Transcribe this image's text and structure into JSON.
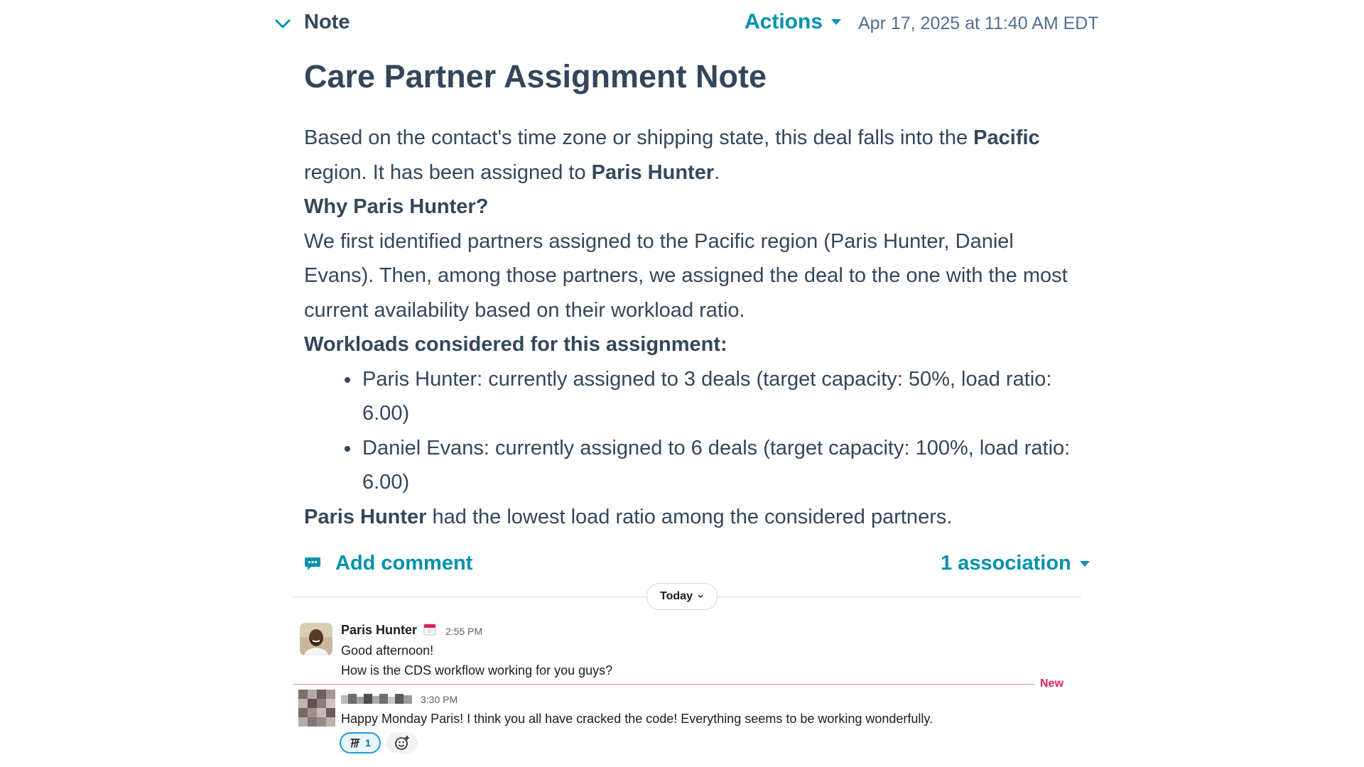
{
  "note": {
    "label": "Note",
    "actions_label": "Actions",
    "timestamp": "Apr 17, 2025 at 11:40 AM EDT",
    "title": "Care Partner Assignment Note",
    "intro_1": "Based on the contact's time zone or shipping state, this deal falls into the ",
    "region_bold": "Pacific",
    "intro_2": " region. It has been assigned to ",
    "assignee_bold": "Paris Hunter",
    "intro_3": ".",
    "why_heading": "Why Paris Hunter?",
    "why_text": "We first identified partners assigned to the Pacific region (Paris Hunter, Daniel Evans). Then, among those partners, we assigned the deal to the one with the most current availability based on their workload ratio.",
    "workloads_heading": "Workloads considered for this assignment:",
    "workloads": [
      "Paris Hunter: currently assigned to 3 deals (target capacity: 50%, load ratio: 6.00)",
      "Daniel Evans: currently assigned to 6 deals (target capacity: 100%, load ratio: 6.00)"
    ],
    "conclusion_bold": "Paris Hunter",
    "conclusion_text": " had the lowest load ratio among the considered partners.",
    "add_comment_label": "Add comment",
    "association_label": "1 association"
  },
  "chat": {
    "date_pill": "Today",
    "new_label": "New",
    "messages": [
      {
        "author": "Paris Hunter",
        "time": "2:55 PM",
        "lines": [
          "Good afternoon!",
          "How is the CDS workflow working for you guys?"
        ]
      },
      {
        "author": "",
        "time": "3:30 PM",
        "lines": [
          "Happy Monday Paris! I think you all have cracked the code! Everything seems to be working wonderfully."
        ],
        "reaction_count": "1"
      }
    ]
  },
  "icons": {
    "collapse": "chevron-down-icon",
    "comment": "comment-bubble-icon",
    "calendar_status": "calendar-icon",
    "reaction": "custom-emoji-icon",
    "add_reaction": "add-reaction-icon"
  },
  "colors": {
    "link": "#0091ae",
    "text": "#33475b",
    "new_marker": "#e01e5a"
  }
}
